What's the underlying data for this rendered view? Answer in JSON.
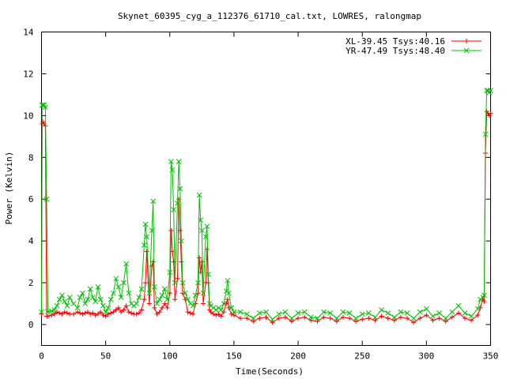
{
  "chart_data": {
    "type": "line",
    "title": "Skynet_60395_cyg_a_112376_61710_cal.txt, LOWRES, ralongmap",
    "xlabel": "Time(Seconds)",
    "ylabel": "Power (Kelvin)",
    "xlim": [
      0,
      350
    ],
    "ylim": [
      -1,
      14
    ],
    "xticks": [
      0,
      50,
      100,
      150,
      200,
      250,
      300,
      350
    ],
    "yticks": [
      0,
      2,
      4,
      6,
      8,
      10,
      12,
      14
    ],
    "grid": false,
    "legend_position": "top-right",
    "series": [
      {
        "name": "XL-39.45 Tsys:40.16",
        "color": "#ff0000",
        "marker": "+",
        "x": [
          0,
          0.5,
          1,
          2,
          3,
          4,
          5,
          8,
          10,
          12,
          14,
          16,
          18,
          20,
          22,
          25,
          28,
          30,
          32,
          34,
          36,
          38,
          40,
          42,
          44,
          46,
          48,
          50,
          52,
          54,
          56,
          58,
          60,
          62,
          64,
          66,
          68,
          70,
          72,
          74,
          76,
          78,
          80,
          81,
          82,
          84,
          86,
          87,
          88,
          90,
          92,
          94,
          96,
          98,
          100,
          101,
          102,
          103,
          104,
          106,
          107,
          108,
          109,
          110,
          112,
          114,
          116,
          118,
          120,
          122,
          123,
          124,
          125,
          126,
          128,
          129,
          130,
          131,
          132,
          134,
          136,
          138,
          140,
          142,
          144,
          145,
          146,
          148,
          150,
          155,
          160,
          165,
          170,
          175,
          180,
          185,
          190,
          195,
          200,
          205,
          210,
          215,
          220,
          225,
          230,
          235,
          240,
          245,
          250,
          255,
          260,
          265,
          270,
          275,
          280,
          285,
          290,
          295,
          300,
          305,
          310,
          315,
          320,
          325,
          330,
          335,
          340,
          342,
          344,
          345,
          346,
          347,
          348,
          349,
          350
        ],
        "y": [
          0.5,
          9.6,
          9.7,
          9.6,
          9.5,
          0.4,
          0.4,
          0.45,
          0.5,
          0.6,
          0.55,
          0.5,
          0.6,
          0.55,
          0.5,
          0.5,
          0.6,
          0.55,
          0.5,
          0.55,
          0.6,
          0.5,
          0.55,
          0.45,
          0.5,
          0.6,
          0.45,
          0.4,
          0.5,
          0.55,
          0.6,
          0.7,
          0.8,
          0.6,
          0.7,
          0.9,
          0.6,
          0.55,
          0.5,
          0.5,
          0.55,
          0.7,
          1.2,
          2.0,
          3.5,
          1.0,
          2.8,
          3.0,
          0.8,
          0.5,
          0.6,
          0.8,
          1.0,
          0.8,
          1.5,
          4.5,
          3.5,
          3.0,
          1.2,
          2.2,
          6.0,
          4.5,
          3.0,
          1.5,
          1.2,
          0.6,
          0.55,
          0.5,
          1.0,
          1.5,
          3.2,
          2.5,
          3.0,
          1.0,
          2.0,
          3.6,
          2.0,
          0.7,
          0.6,
          0.5,
          0.45,
          0.5,
          0.4,
          0.6,
          1.0,
          1.2,
          0.8,
          0.5,
          0.45,
          0.3,
          0.3,
          0.15,
          0.3,
          0.35,
          0.1,
          0.3,
          0.35,
          0.15,
          0.3,
          0.35,
          0.2,
          0.15,
          0.35,
          0.3,
          0.15,
          0.35,
          0.3,
          0.15,
          0.25,
          0.3,
          0.2,
          0.4,
          0.3,
          0.2,
          0.35,
          0.3,
          0.1,
          0.3,
          0.45,
          0.2,
          0.3,
          0.15,
          0.35,
          0.55,
          0.3,
          0.2,
          0.45,
          0.8,
          1.2,
          1.1,
          8.2,
          10.2,
          10.1,
          10.0,
          10.1
        ]
      },
      {
        "name": "YR-47.49 Tsys:48.40",
        "color": "#00c000",
        "marker": "x",
        "x": [
          0,
          0.5,
          1,
          2,
          3,
          4,
          5,
          8,
          10,
          12,
          14,
          16,
          18,
          20,
          22,
          25,
          28,
          30,
          32,
          34,
          36,
          38,
          40,
          42,
          44,
          46,
          48,
          50,
          52,
          54,
          56,
          58,
          60,
          62,
          64,
          66,
          68,
          70,
          72,
          74,
          76,
          78,
          80,
          81,
          82,
          84,
          86,
          87,
          88,
          90,
          92,
          94,
          96,
          98,
          100,
          101,
          102,
          103,
          104,
          106,
          107,
          108,
          109,
          110,
          112,
          114,
          116,
          118,
          120,
          122,
          123,
          124,
          125,
          126,
          128,
          129,
          130,
          131,
          132,
          134,
          136,
          138,
          140,
          142,
          144,
          145,
          146,
          148,
          150,
          155,
          160,
          165,
          170,
          175,
          180,
          185,
          190,
          195,
          200,
          205,
          210,
          215,
          220,
          225,
          230,
          235,
          240,
          245,
          250,
          255,
          260,
          265,
          270,
          275,
          280,
          285,
          290,
          295,
          300,
          305,
          310,
          315,
          320,
          325,
          330,
          335,
          340,
          342,
          344,
          345,
          346,
          347,
          348,
          349,
          350
        ],
        "y": [
          0.6,
          10.5,
          10.5,
          10.5,
          10.4,
          6.0,
          0.6,
          0.65,
          0.7,
          0.9,
          1.2,
          1.4,
          1.1,
          0.9,
          1.3,
          1.0,
          0.8,
          1.3,
          1.5,
          1.0,
          1.2,
          1.7,
          1.3,
          1.1,
          1.8,
          1.2,
          0.9,
          0.6,
          0.8,
          1.2,
          1.5,
          2.2,
          1.8,
          1.3,
          2.0,
          2.9,
          1.5,
          1.0,
          0.9,
          1.0,
          1.3,
          1.7,
          3.8,
          4.8,
          4.2,
          1.5,
          4.5,
          5.9,
          1.8,
          1.0,
          1.2,
          1.4,
          1.7,
          1.2,
          2.5,
          7.8,
          7.4,
          5.5,
          2.0,
          5.8,
          7.8,
          6.5,
          4.0,
          2.0,
          1.5,
          1.2,
          1.0,
          0.9,
          1.4,
          2.0,
          6.2,
          5.0,
          4.5,
          1.5,
          4.2,
          4.7,
          2.4,
          1.0,
          0.9,
          0.8,
          0.7,
          0.8,
          0.7,
          1.0,
          1.6,
          2.1,
          1.5,
          0.8,
          0.6,
          0.6,
          0.5,
          0.3,
          0.55,
          0.6,
          0.25,
          0.5,
          0.6,
          0.3,
          0.55,
          0.6,
          0.35,
          0.3,
          0.6,
          0.55,
          0.3,
          0.6,
          0.55,
          0.3,
          0.5,
          0.55,
          0.35,
          0.7,
          0.55,
          0.35,
          0.6,
          0.55,
          0.3,
          0.6,
          0.75,
          0.4,
          0.55,
          0.3,
          0.6,
          0.9,
          0.55,
          0.4,
          0.75,
          1.2,
          1.3,
          1.4,
          9.1,
          11.2,
          11.2,
          11.1,
          11.2
        ]
      }
    ]
  }
}
